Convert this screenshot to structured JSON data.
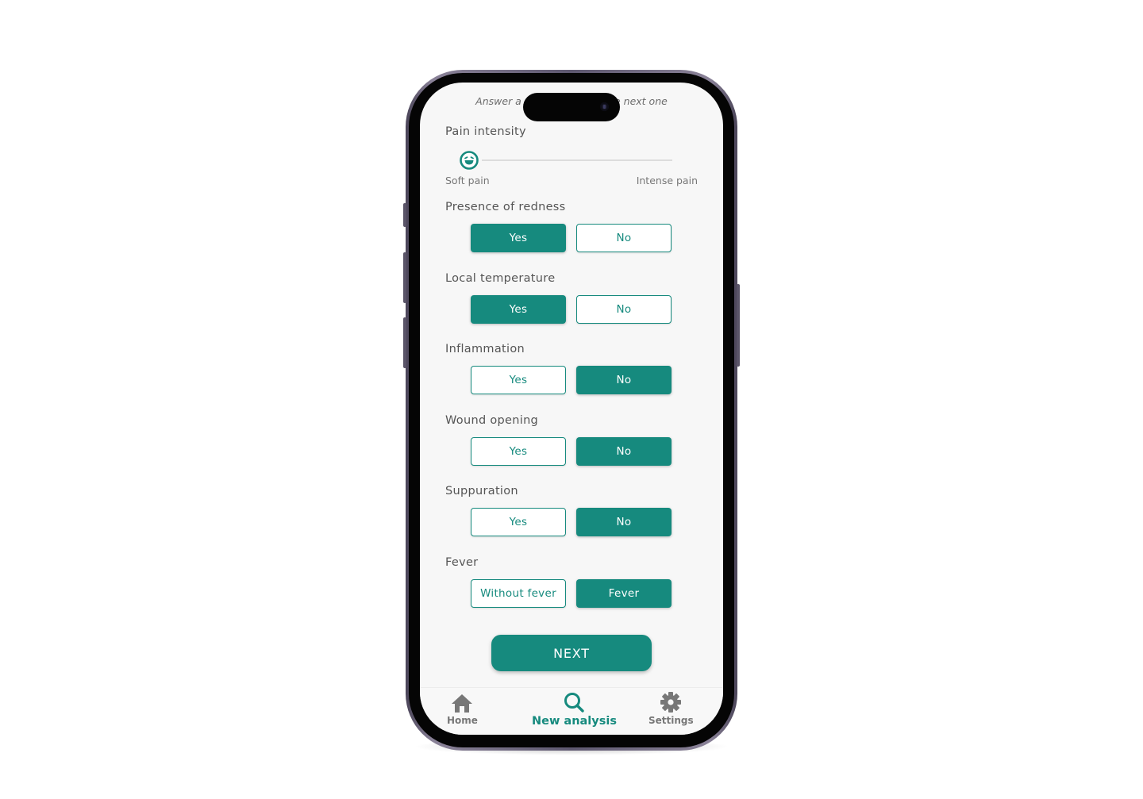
{
  "colors": {
    "accent": "#168a7e",
    "label": "#555555",
    "inactive_nav": "#777777",
    "screen_bg": "#f7f7f7"
  },
  "header": {
    "hint": "Answer a question to see the next one"
  },
  "pain": {
    "label": "Pain intensity",
    "min_label": "Soft pain",
    "max_label": "Intense pain",
    "value_fraction": 0.0,
    "thumb_icon": "laughing-face-icon"
  },
  "questions": [
    {
      "label": "Presence of redness",
      "options": [
        "Yes",
        "No"
      ],
      "selected": "Yes"
    },
    {
      "label": "Local temperature",
      "options": [
        "Yes",
        "No"
      ],
      "selected": "Yes"
    },
    {
      "label": "Inflammation",
      "options": [
        "Yes",
        "No"
      ],
      "selected": "No"
    },
    {
      "label": "Wound opening",
      "options": [
        "Yes",
        "No"
      ],
      "selected": "No"
    },
    {
      "label": "Suppuration",
      "options": [
        "Yes",
        "No"
      ],
      "selected": "No"
    },
    {
      "label": "Fever",
      "options": [
        "Without fever",
        "Fever"
      ],
      "selected": "Fever"
    }
  ],
  "next_label": "NEXT",
  "nav": {
    "items": [
      {
        "label": "Home",
        "icon": "home-icon",
        "active": false
      },
      {
        "label": "New analysis",
        "icon": "search-icon",
        "active": true
      },
      {
        "label": "Settings",
        "icon": "gear-icon",
        "active": false
      }
    ]
  }
}
